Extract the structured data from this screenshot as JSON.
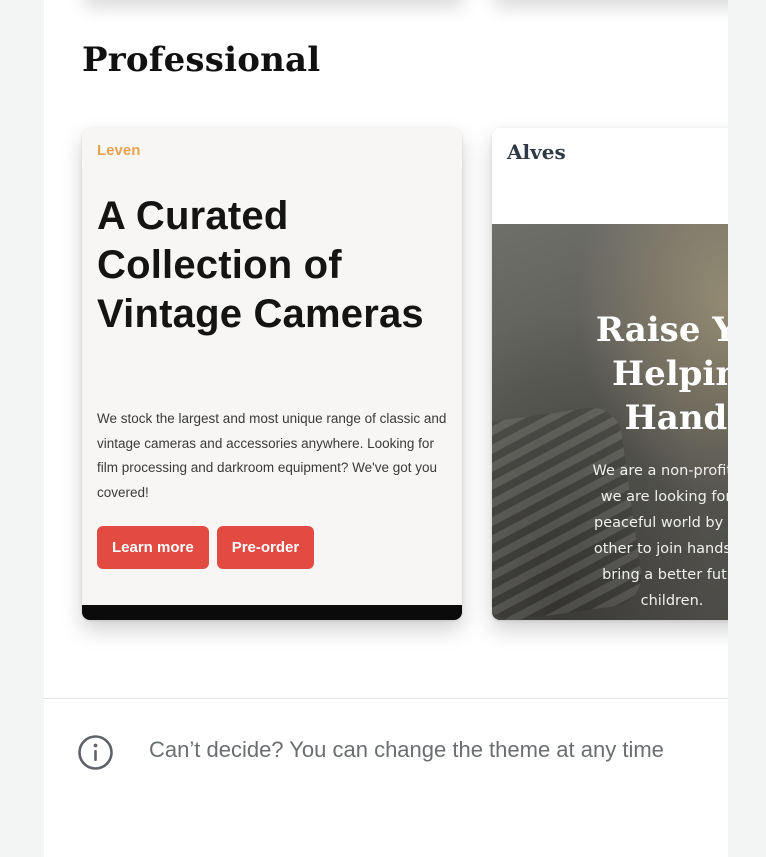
{
  "section": {
    "title": "Professional"
  },
  "themes": [
    {
      "brand": "Leven",
      "headline": "A Curated Collection of Vintage Cameras",
      "body": "We stock the largest and most unique range of classic and vintage cameras and accessories anywhere. Looking for film processing and darkroom equipment? We've got you covered!",
      "buttons": [
        "Learn more",
        "Pre-order"
      ],
      "colors": {
        "brand": "#e8a24e",
        "button": "#e24b42",
        "background": "#f7f6f4"
      }
    },
    {
      "brand": "Alves",
      "headline": "Raise Yo\nHelpin\nHand",
      "body": "We are a non-profit or\nwe are looking forw\npeaceful world by hel\nother to join hands to\nbring a better futur\nchildren.",
      "colors": {
        "brand": "#2f3a45"
      }
    }
  ],
  "footer": {
    "icon": "info-icon",
    "message": "Can’t decide? You can change the theme at any time"
  }
}
